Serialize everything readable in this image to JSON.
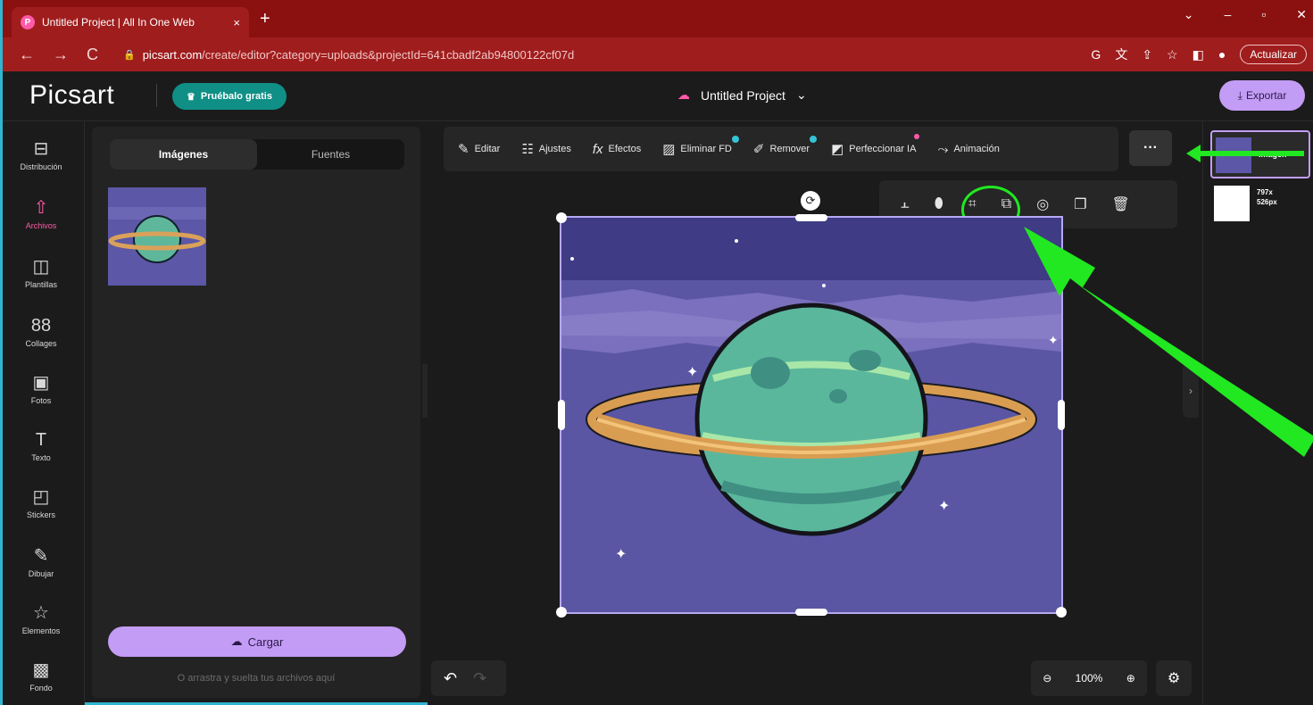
{
  "browser": {
    "tab_title": "Untitled Project | All In One Web",
    "tab_close": "×",
    "new_tab": "+",
    "window_controls": [
      "⌄",
      "–",
      "▫",
      "✕"
    ],
    "url_host": "picsart.com",
    "url_path": "/create/editor?category=uploads&projectId=641cbadf2ab94800122cf07d",
    "update_label": "Actualizar"
  },
  "header": {
    "logo": "Picsart",
    "trial_label": "Pruébalo gratis",
    "project_title": "Untitled Project",
    "export_label": "Exportar"
  },
  "sidebar": {
    "items": [
      {
        "label": "Distribución",
        "icon": "⊟"
      },
      {
        "label": "Archivos",
        "icon": "⇧"
      },
      {
        "label": "Plantillas",
        "icon": "◫"
      },
      {
        "label": "Collages",
        "icon": "88"
      },
      {
        "label": "Fotos",
        "icon": "▣"
      },
      {
        "label": "Texto",
        "icon": "T"
      },
      {
        "label": "Stickers",
        "icon": "◰"
      },
      {
        "label": "Dibujar",
        "icon": "✎"
      },
      {
        "label": "Elementos",
        "icon": "☆"
      },
      {
        "label": "Fondo",
        "icon": "▩"
      }
    ]
  },
  "panel": {
    "tabs": [
      "Imágenes",
      "Fuentes"
    ],
    "upload_label": "Cargar",
    "hint": "O arrastra y suelta tus archivos aquí"
  },
  "toolbar": {
    "items": [
      {
        "label": "Editar",
        "icon": "✎"
      },
      {
        "label": "Ajustes",
        "icon": "☷"
      },
      {
        "label": "Efectos",
        "icon": "fx"
      },
      {
        "label": "Eliminar FD",
        "icon": "▨"
      },
      {
        "label": "Remover",
        "icon": "✐"
      },
      {
        "label": "Perfeccionar IA",
        "icon": "◩"
      },
      {
        "label": "Animación",
        "icon": "⤳"
      }
    ],
    "more": "···"
  },
  "mini_toolbar": [
    "⫠",
    "⬮",
    "⌗",
    "⧉",
    "◎",
    "❐",
    "🗑"
  ],
  "zoom": {
    "level": "100%",
    "minus": "⊖",
    "plus": "⊕"
  },
  "layers": [
    {
      "label": "Imagen"
    },
    {
      "label": "797x 526px"
    }
  ],
  "colors": {
    "accent": "#c39cf5",
    "brand": "#ff5aa8",
    "highlight": "#21e821"
  }
}
